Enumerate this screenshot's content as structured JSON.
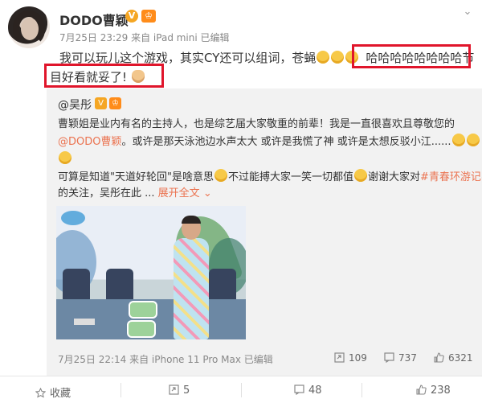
{
  "author": {
    "name": "DODO曹颖",
    "verified_badge": "V",
    "level_badge": "♔"
  },
  "post_meta": "7月25日 23:29 来自 iPad mini  已编辑",
  "post_text": {
    "line1_start": "我可以玩儿这个游戏，其实CY还可以组词，苍蝇",
    "line1_highlight": "哈哈哈哈哈哈哈哈节",
    "line2_highlight": "目好看就妥了!"
  },
  "repost": {
    "author": "@吴彤",
    "verified_badge": "V",
    "level_badge": "♔",
    "line1": "曹颖姐是业内有名的主持人，也是综艺届大家敬重的前辈！我是一直很喜欢且尊敬您的",
    "line2_mention": "@DODO曹颖",
    "line2_rest": "。或许是那天泳池边水声太大 或许是我慌了神 或许是太想反驳小江......",
    "line4_a": "可算是知道\"天道好轮回\"是啥意思",
    "line4_b": "不过能搏大家一笑一切都值",
    "line4_c": "谢谢大家对",
    "line4_tag": "#青春环游记#",
    "line5": "的关注，吴彤在此 ...",
    "expand_label": "展开全文",
    "expand_icon": "chevron-down-icon",
    "footer_meta": "7月25日 22:14 来自 iPhone 11 Pro Max  已编辑",
    "stats": {
      "reposts": "109",
      "comments": "737",
      "likes": "6321"
    }
  },
  "actions": {
    "favorite": "收藏",
    "repost": "5",
    "comment": "48",
    "like": "238"
  },
  "colors": {
    "highlight_box": "#e0152b",
    "link": "#eb7350",
    "repost_bg": "#f2f2f2"
  }
}
